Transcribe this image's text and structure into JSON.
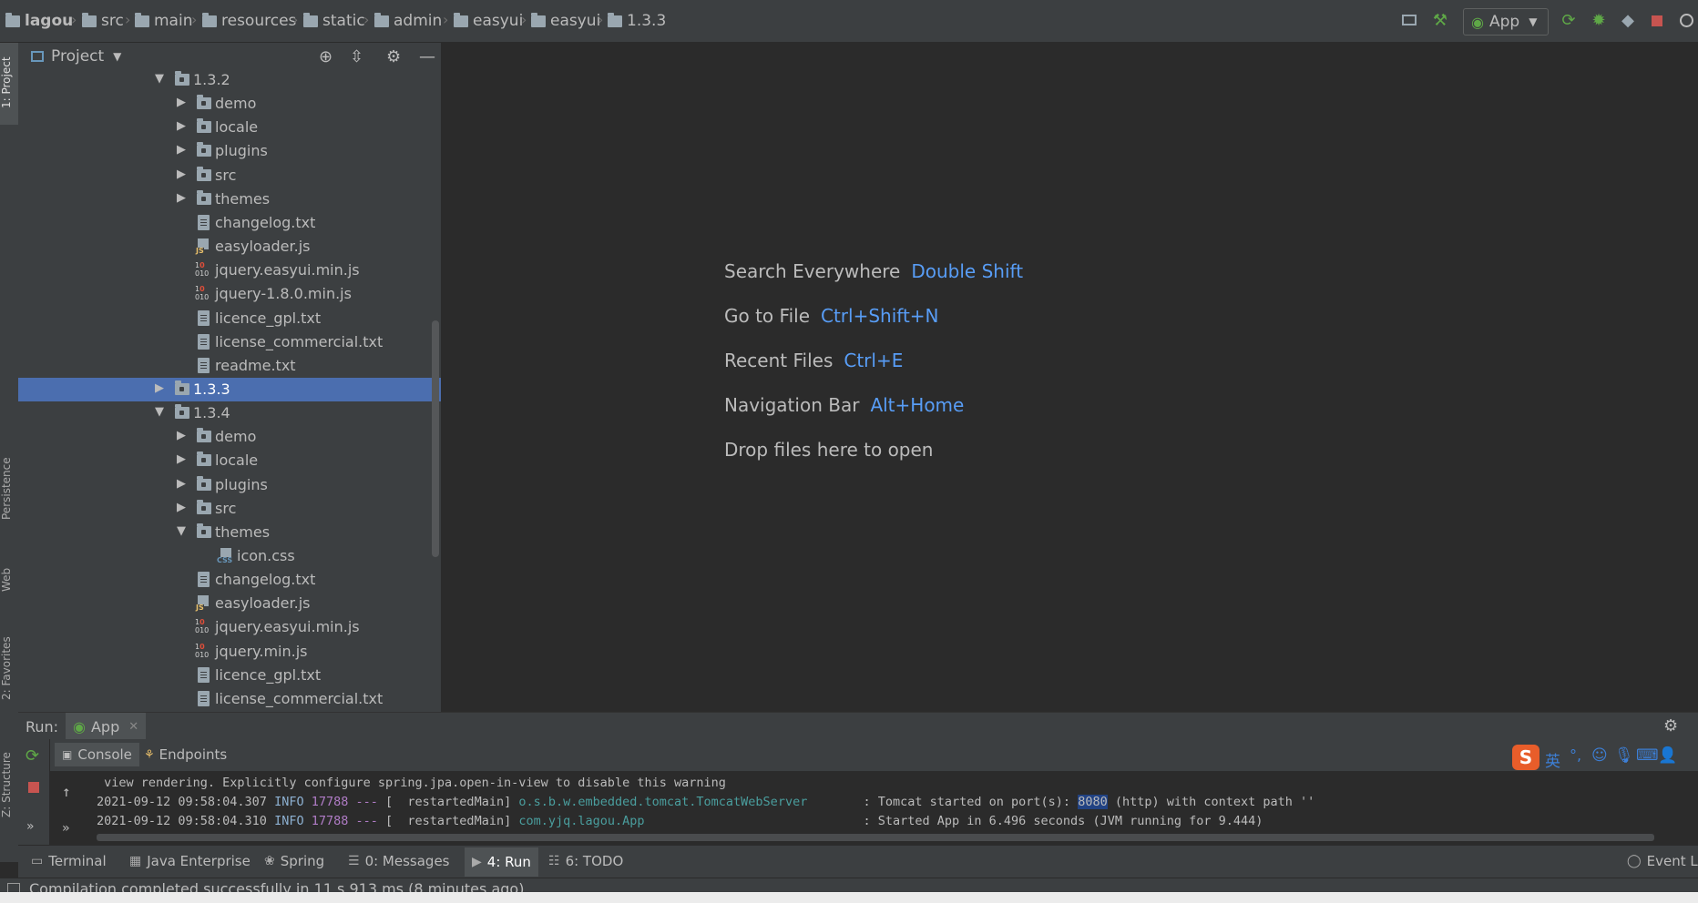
{
  "breadcrumb": [
    "lagou",
    "src",
    "main",
    "resources",
    "static",
    "admin",
    "easyui",
    "easyui",
    "1.3.3"
  ],
  "toolbar": {
    "run_config": "App"
  },
  "left_strip": {
    "project": "1: Project",
    "persistence": "Persistence",
    "web": "Web",
    "favorites": "2: Favorites",
    "structure": "Z: Structure"
  },
  "project_panel": {
    "title": "Project",
    "tree": [
      {
        "label": "1.3.2",
        "type": "folder",
        "depth": 0,
        "state": "open"
      },
      {
        "label": "demo",
        "type": "folder",
        "depth": 1,
        "state": "closed"
      },
      {
        "label": "locale",
        "type": "folder",
        "depth": 1,
        "state": "closed"
      },
      {
        "label": "plugins",
        "type": "folder",
        "depth": 1,
        "state": "closed"
      },
      {
        "label": "src",
        "type": "folder",
        "depth": 1,
        "state": "closed"
      },
      {
        "label": "themes",
        "type": "folder",
        "depth": 1,
        "state": "closed"
      },
      {
        "label": "changelog.txt",
        "type": "txt",
        "depth": 1
      },
      {
        "label": "easyloader.js",
        "type": "js",
        "depth": 1
      },
      {
        "label": "jquery.easyui.min.js",
        "type": "bin",
        "depth": 1
      },
      {
        "label": "jquery-1.8.0.min.js",
        "type": "bin",
        "depth": 1
      },
      {
        "label": "licence_gpl.txt",
        "type": "txt",
        "depth": 1
      },
      {
        "label": "license_commercial.txt",
        "type": "txt",
        "depth": 1
      },
      {
        "label": "readme.txt",
        "type": "txt",
        "depth": 1
      },
      {
        "label": "1.3.3",
        "type": "folder",
        "depth": 0,
        "state": "closed",
        "selected": true
      },
      {
        "label": "1.3.4",
        "type": "folder",
        "depth": 0,
        "state": "open"
      },
      {
        "label": "demo",
        "type": "folder",
        "depth": 1,
        "state": "closed"
      },
      {
        "label": "locale",
        "type": "folder",
        "depth": 1,
        "state": "closed"
      },
      {
        "label": "plugins",
        "type": "folder",
        "depth": 1,
        "state": "closed"
      },
      {
        "label": "src",
        "type": "folder",
        "depth": 1,
        "state": "closed"
      },
      {
        "label": "themes",
        "type": "folder",
        "depth": 1,
        "state": "open"
      },
      {
        "label": "icon.css",
        "type": "css",
        "depth": 2
      },
      {
        "label": "changelog.txt",
        "type": "txt",
        "depth": 1
      },
      {
        "label": "easyloader.js",
        "type": "js",
        "depth": 1
      },
      {
        "label": "jquery.easyui.min.js",
        "type": "bin",
        "depth": 1
      },
      {
        "label": "jquery.min.js",
        "type": "bin",
        "depth": 1
      },
      {
        "label": "licence_gpl.txt",
        "type": "txt",
        "depth": 1
      },
      {
        "label": "license_commercial.txt",
        "type": "txt",
        "depth": 1
      }
    ]
  },
  "editor": {
    "hints": [
      {
        "text": "Search Everywhere",
        "key": "Double Shift"
      },
      {
        "text": "Go to File",
        "key": "Ctrl+Shift+N"
      },
      {
        "text": "Recent Files",
        "key": "Ctrl+E"
      },
      {
        "text": "Navigation Bar",
        "key": "Alt+Home"
      },
      {
        "text": "Drop files here to open",
        "key": ""
      }
    ]
  },
  "run_panel": {
    "label": "Run:",
    "tab": "App",
    "subtabs": [
      "Console",
      "Endpoints"
    ],
    "lines": [
      {
        "date": "",
        "level": "",
        "pid": "",
        "thread": "",
        "logger": "",
        "message": " view rendering. Explicitly configure spring.jpa.open-in-view to disable this warning"
      },
      {
        "date": "2021-09-12 09:58:04.307",
        "level": "INFO",
        "pid": "17788 ---",
        "thread": "[  restartedMain]",
        "logger": "o.s.b.w.embedded.tomcat.TomcatWebServer",
        "message": ": Tomcat started on port(s): ",
        "port": "8080",
        "message_tail": " (http) with context path ''"
      },
      {
        "date": "2021-09-12 09:58:04.310",
        "level": "INFO",
        "pid": "17788 ---",
        "thread": "[  restartedMain]",
        "logger": "com.yjq.lagou.App",
        "message": ": Started App in 6.496 seconds (JVM running for 9.444)"
      }
    ]
  },
  "bottom_tabs": [
    {
      "label": "Terminal",
      "icon": "terminal-icon"
    },
    {
      "label": "Java Enterprise",
      "icon": "java-enterprise-icon"
    },
    {
      "label": "Spring",
      "icon": "spring-icon"
    },
    {
      "label": "0: Messages",
      "icon": "messages-icon"
    },
    {
      "label": "4: Run",
      "icon": "run-icon"
    },
    {
      "label": "6: TODO",
      "icon": "todo-icon"
    }
  ],
  "event_log": "Event Lo",
  "status": "Compilation completed successfully in 11 s 913 ms (8 minutes ago)",
  "ime": {
    "lang": "英"
  },
  "colors": {
    "selection": "#4b6eaf",
    "link": "#589df6",
    "background": "#2b2b2b",
    "panel": "#3c3f41"
  }
}
